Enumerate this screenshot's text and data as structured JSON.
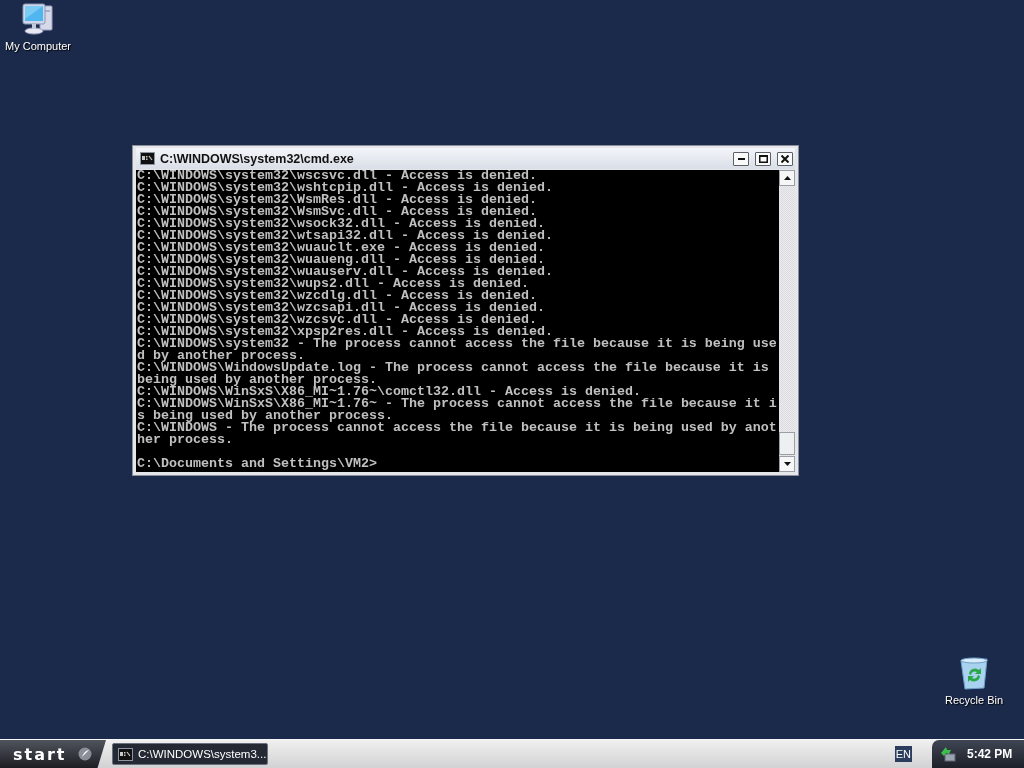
{
  "desktop_icons": [
    {
      "kind": "computer",
      "label": "My Computer"
    },
    {
      "kind": "recycle-bin",
      "label": "Recycle Bin"
    }
  ],
  "window": {
    "title": "C:\\WINDOWS\\system32\\cmd.exe",
    "console": {
      "lines": [
        "C:\\WINDOWS\\system32\\wscsvc.dll - Access is denied.",
        "C:\\WINDOWS\\system32\\wshtcpip.dll - Access is denied.",
        "C:\\WINDOWS\\system32\\WsmRes.dll - Access is denied.",
        "C:\\WINDOWS\\system32\\WsmSvc.dll - Access is denied.",
        "C:\\WINDOWS\\system32\\wsock32.dll - Access is denied.",
        "C:\\WINDOWS\\system32\\wtsapi32.dll - Access is denied.",
        "C:\\WINDOWS\\system32\\wuauclt.exe - Access is denied.",
        "C:\\WINDOWS\\system32\\wuaueng.dll - Access is denied.",
        "C:\\WINDOWS\\system32\\wuauserv.dll - Access is denied.",
        "C:\\WINDOWS\\system32\\wups2.dll - Access is denied.",
        "C:\\WINDOWS\\system32\\wzcdlg.dll - Access is denied.",
        "C:\\WINDOWS\\system32\\wzcsapi.dll - Access is denied.",
        "C:\\WINDOWS\\system32\\wzcsvc.dll - Access is denied.",
        "C:\\WINDOWS\\system32\\xpsp2res.dll - Access is denied.",
        "C:\\WINDOWS\\system32 - The process cannot access the file because it is being use",
        "d by another process.",
        "C:\\WINDOWS\\WindowsUpdate.log - The process cannot access the file because it is",
        "being used by another process.",
        "C:\\WINDOWS\\WinSxS\\X86_MI~1.76~\\comctl32.dll - Access is denied.",
        "C:\\WINDOWS\\WinSxS\\X86_MI~1.76~ - The process cannot access the file because it i",
        "s being used by another process.",
        "C:\\WINDOWS - The process cannot access the file because it is being used by anot",
        "her process."
      ],
      "prompt": "C:\\Documents and Settings\\VM2>"
    }
  },
  "taskbar": {
    "start_label": "start",
    "tasks": [
      {
        "label": "C:\\WINDOWS\\system3...",
        "selected": true
      }
    ],
    "language": "EN",
    "clock": "5:42 PM"
  }
}
